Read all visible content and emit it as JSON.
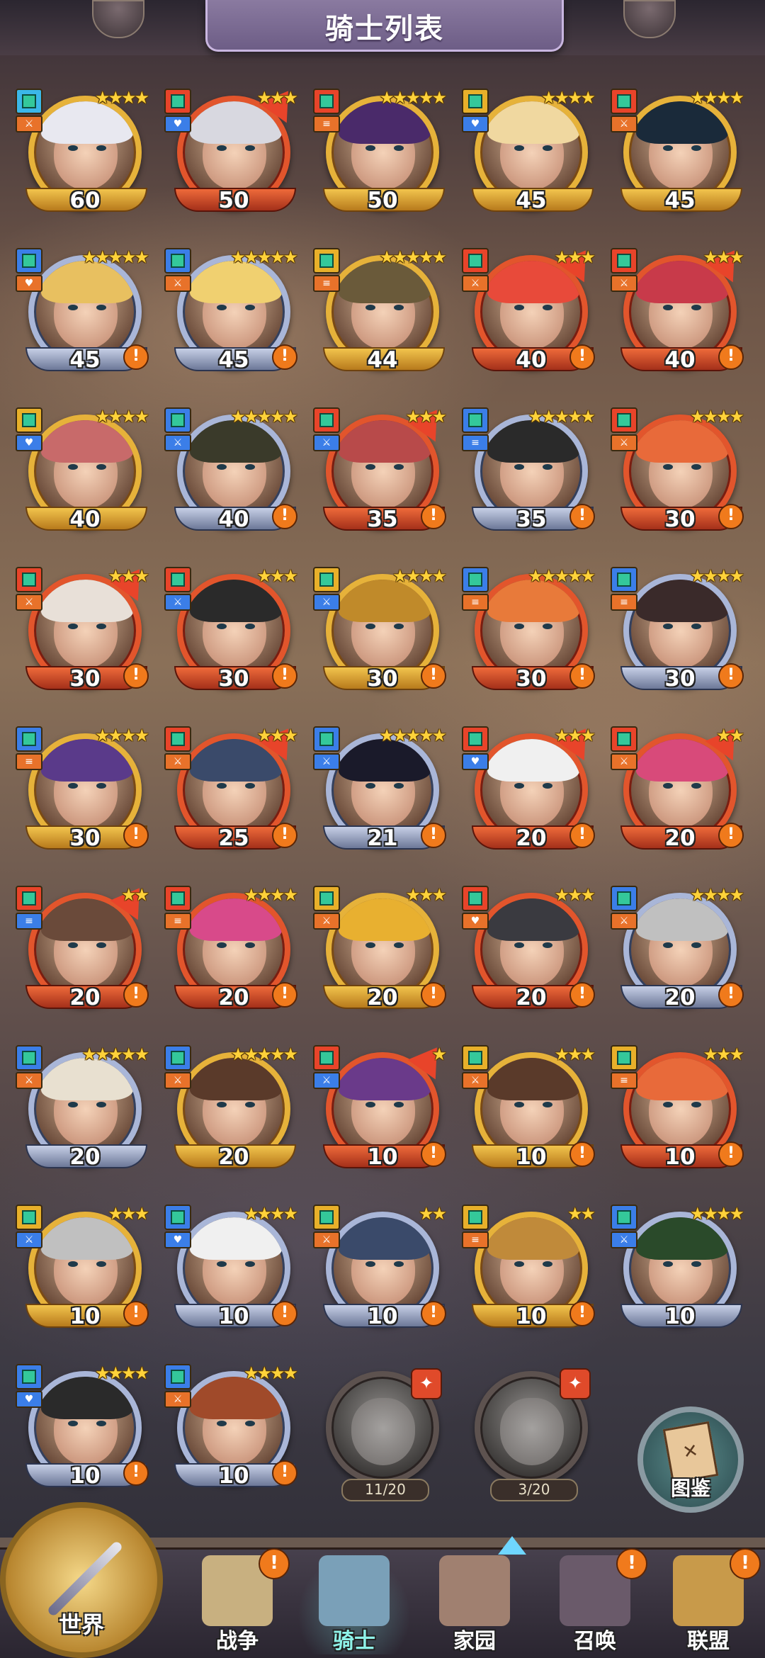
{
  "header": {
    "title": "骑士列表"
  },
  "knights": [
    {
      "level": "60",
      "stars": 4,
      "frame": "gold",
      "alert": false,
      "upgrade": false,
      "rarity_color": "#3bb7e8",
      "role": "⚔",
      "role_color": "#e8722a"
    },
    {
      "level": "50",
      "stars": 3,
      "frame": "red",
      "alert": false,
      "upgrade": true,
      "rarity_color": "#e8442a",
      "role": "♥",
      "role_color": "#3b7ee8"
    },
    {
      "level": "50",
      "stars": 5,
      "frame": "gold",
      "alert": false,
      "upgrade": false,
      "rarity_color": "#e8442a",
      "role": "≡",
      "role_color": "#e8722a"
    },
    {
      "level": "45",
      "stars": 4,
      "frame": "gold",
      "alert": false,
      "upgrade": false,
      "rarity_color": "#e8b02a",
      "role": "♥",
      "role_color": "#3b7ee8"
    },
    {
      "level": "45",
      "stars": 4,
      "frame": "gold",
      "alert": false,
      "upgrade": false,
      "rarity_color": "#e8442a",
      "role": "⚔",
      "role_color": "#e8722a"
    },
    {
      "level": "45",
      "stars": 5,
      "frame": "blue",
      "alert": true,
      "upgrade": false,
      "rarity_color": "#3b7ee8",
      "role": "♥",
      "role_color": "#e8722a"
    },
    {
      "level": "45",
      "stars": 5,
      "frame": "blue",
      "alert": true,
      "upgrade": false,
      "rarity_color": "#3b7ee8",
      "role": "⚔",
      "role_color": "#e8722a"
    },
    {
      "level": "44",
      "stars": 5,
      "frame": "gold",
      "alert": false,
      "upgrade": false,
      "rarity_color": "#e8b02a",
      "role": "≡",
      "role_color": "#e8722a"
    },
    {
      "level": "40",
      "stars": 3,
      "frame": "red",
      "alert": true,
      "upgrade": true,
      "rarity_color": "#e8442a",
      "role": "⚔",
      "role_color": "#e8722a"
    },
    {
      "level": "40",
      "stars": 3,
      "frame": "red",
      "alert": true,
      "upgrade": true,
      "rarity_color": "#e8442a",
      "role": "⚔",
      "role_color": "#e8722a"
    },
    {
      "level": "40",
      "stars": 4,
      "frame": "gold",
      "alert": false,
      "upgrade": false,
      "rarity_color": "#e8b02a",
      "role": "♥",
      "role_color": "#3b7ee8"
    },
    {
      "level": "40",
      "stars": 5,
      "frame": "blue",
      "alert": true,
      "upgrade": false,
      "rarity_color": "#3b7ee8",
      "role": "⚔",
      "role_color": "#3b7ee8"
    },
    {
      "level": "35",
      "stars": 3,
      "frame": "red",
      "alert": true,
      "upgrade": true,
      "rarity_color": "#e8442a",
      "role": "⚔",
      "role_color": "#3b7ee8"
    },
    {
      "level": "35",
      "stars": 5,
      "frame": "blue",
      "alert": true,
      "upgrade": false,
      "rarity_color": "#3b7ee8",
      "role": "≡",
      "role_color": "#3b7ee8"
    },
    {
      "level": "30",
      "stars": 4,
      "frame": "red",
      "alert": true,
      "upgrade": false,
      "rarity_color": "#e8442a",
      "role": "⚔",
      "role_color": "#e8722a"
    },
    {
      "level": "30",
      "stars": 3,
      "frame": "red",
      "alert": true,
      "upgrade": true,
      "rarity_color": "#e8442a",
      "role": "⚔",
      "role_color": "#e8722a"
    },
    {
      "level": "30",
      "stars": 3,
      "frame": "red",
      "alert": true,
      "upgrade": false,
      "rarity_color": "#e8442a",
      "role": "⚔",
      "role_color": "#3b7ee8"
    },
    {
      "level": "30",
      "stars": 4,
      "frame": "gold",
      "alert": true,
      "upgrade": false,
      "rarity_color": "#e8b02a",
      "role": "⚔",
      "role_color": "#3b7ee8"
    },
    {
      "level": "30",
      "stars": 5,
      "frame": "red",
      "alert": true,
      "upgrade": false,
      "rarity_color": "#3b7ee8",
      "role": "≡",
      "role_color": "#e8722a"
    },
    {
      "level": "30",
      "stars": 4,
      "frame": "blue",
      "alert": true,
      "upgrade": false,
      "rarity_color": "#3b7ee8",
      "role": "≡",
      "role_color": "#e8722a"
    },
    {
      "level": "30",
      "stars": 4,
      "frame": "gold",
      "alert": true,
      "upgrade": false,
      "rarity_color": "#3b7ee8",
      "role": "≡",
      "role_color": "#e8722a"
    },
    {
      "level": "25",
      "stars": 3,
      "frame": "red",
      "alert": true,
      "upgrade": true,
      "rarity_color": "#e8442a",
      "role": "⚔",
      "role_color": "#e8722a"
    },
    {
      "level": "21",
      "stars": 5,
      "frame": "blue",
      "alert": true,
      "upgrade": false,
      "rarity_color": "#3b7ee8",
      "role": "⚔",
      "role_color": "#3b7ee8"
    },
    {
      "level": "20",
      "stars": 3,
      "frame": "red",
      "alert": true,
      "upgrade": true,
      "rarity_color": "#e8442a",
      "role": "♥",
      "role_color": "#3b7ee8"
    },
    {
      "level": "20",
      "stars": 2,
      "frame": "red",
      "alert": true,
      "upgrade": true,
      "rarity_color": "#e8442a",
      "role": "⚔",
      "role_color": "#e8722a"
    },
    {
      "level": "20",
      "stars": 2,
      "frame": "red",
      "alert": true,
      "upgrade": true,
      "rarity_color": "#e8442a",
      "role": "≡",
      "role_color": "#3b7ee8"
    },
    {
      "level": "20",
      "stars": 4,
      "frame": "red",
      "alert": true,
      "upgrade": false,
      "rarity_color": "#e8442a",
      "role": "≡",
      "role_color": "#e8722a"
    },
    {
      "level": "20",
      "stars": 3,
      "frame": "gold",
      "alert": true,
      "upgrade": false,
      "rarity_color": "#e8b02a",
      "role": "⚔",
      "role_color": "#e8722a"
    },
    {
      "level": "20",
      "stars": 3,
      "frame": "red",
      "alert": true,
      "upgrade": false,
      "rarity_color": "#e8442a",
      "role": "♥",
      "role_color": "#e8722a"
    },
    {
      "level": "20",
      "stars": 4,
      "frame": "blue",
      "alert": true,
      "upgrade": false,
      "rarity_color": "#3b7ee8",
      "role": "⚔",
      "role_color": "#e8722a"
    },
    {
      "level": "20",
      "stars": 5,
      "frame": "blue",
      "alert": false,
      "upgrade": false,
      "rarity_color": "#3b7ee8",
      "role": "⚔",
      "role_color": "#e8722a"
    },
    {
      "level": "20",
      "stars": 5,
      "frame": "gold",
      "alert": false,
      "upgrade": false,
      "rarity_color": "#3b7ee8",
      "role": "⚔",
      "role_color": "#e8722a"
    },
    {
      "level": "10",
      "stars": 1,
      "frame": "red",
      "alert": true,
      "upgrade": true,
      "rarity_color": "#e8442a",
      "role": "⚔",
      "role_color": "#3b7ee8"
    },
    {
      "level": "10",
      "stars": 3,
      "frame": "gold",
      "alert": true,
      "upgrade": false,
      "rarity_color": "#e8b02a",
      "role": "⚔",
      "role_color": "#e8722a"
    },
    {
      "level": "10",
      "stars": 3,
      "frame": "red",
      "alert": true,
      "upgrade": false,
      "rarity_color": "#e8b02a",
      "role": "≡",
      "role_color": "#e8722a"
    },
    {
      "level": "10",
      "stars": 3,
      "frame": "gold",
      "alert": true,
      "upgrade": false,
      "rarity_color": "#e8b02a",
      "role": "⚔",
      "role_color": "#3b7ee8"
    },
    {
      "level": "10",
      "stars": 4,
      "frame": "blue",
      "alert": true,
      "upgrade": false,
      "rarity_color": "#3b7ee8",
      "role": "♥",
      "role_color": "#3b7ee8"
    },
    {
      "level": "10",
      "stars": 2,
      "frame": "blue",
      "alert": true,
      "upgrade": false,
      "rarity_color": "#e8b02a",
      "role": "⚔",
      "role_color": "#e8722a"
    },
    {
      "level": "10",
      "stars": 2,
      "frame": "gold",
      "alert": true,
      "upgrade": false,
      "rarity_color": "#e8b02a",
      "role": "≡",
      "role_color": "#e8722a"
    },
    {
      "level": "10",
      "stars": 4,
      "frame": "blue",
      "alert": false,
      "upgrade": false,
      "rarity_color": "#3b7ee8",
      "role": "⚔",
      "role_color": "#3b7ee8"
    },
    {
      "level": "10",
      "stars": 4,
      "frame": "blue",
      "alert": true,
      "upgrade": false,
      "rarity_color": "#3b7ee8",
      "role": "♥",
      "role_color": "#3b7ee8"
    },
    {
      "level": "10",
      "stars": 4,
      "frame": "blue",
      "alert": true,
      "upgrade": false,
      "rarity_color": "#3b7ee8",
      "role": "⚔",
      "role_color": "#e8722a"
    }
  ],
  "locked": [
    {
      "shards": "11/20"
    },
    {
      "shards": "3/20"
    }
  ],
  "codex": {
    "label": "图鉴",
    "icon": "codex-book-icon"
  },
  "nav": {
    "world": "世界",
    "items": [
      {
        "label": "战争",
        "icon": "war-map-icon",
        "alert": true
      },
      {
        "label": "骑士",
        "icon": "knight-icon",
        "alert": false,
        "active": true
      },
      {
        "label": "家园",
        "icon": "home-icon",
        "alert": false
      },
      {
        "label": "召唤",
        "icon": "train-icon",
        "alert": true
      },
      {
        "label": "联盟",
        "icon": "alliance-chest-icon",
        "alert": true
      }
    ],
    "alert_symbol": "!"
  },
  "colors": {
    "alert": "#f07a1c",
    "gold_frame": "#e6b23a",
    "red_frame": "#e2552c",
    "blue_frame": "#a9b6d8"
  }
}
